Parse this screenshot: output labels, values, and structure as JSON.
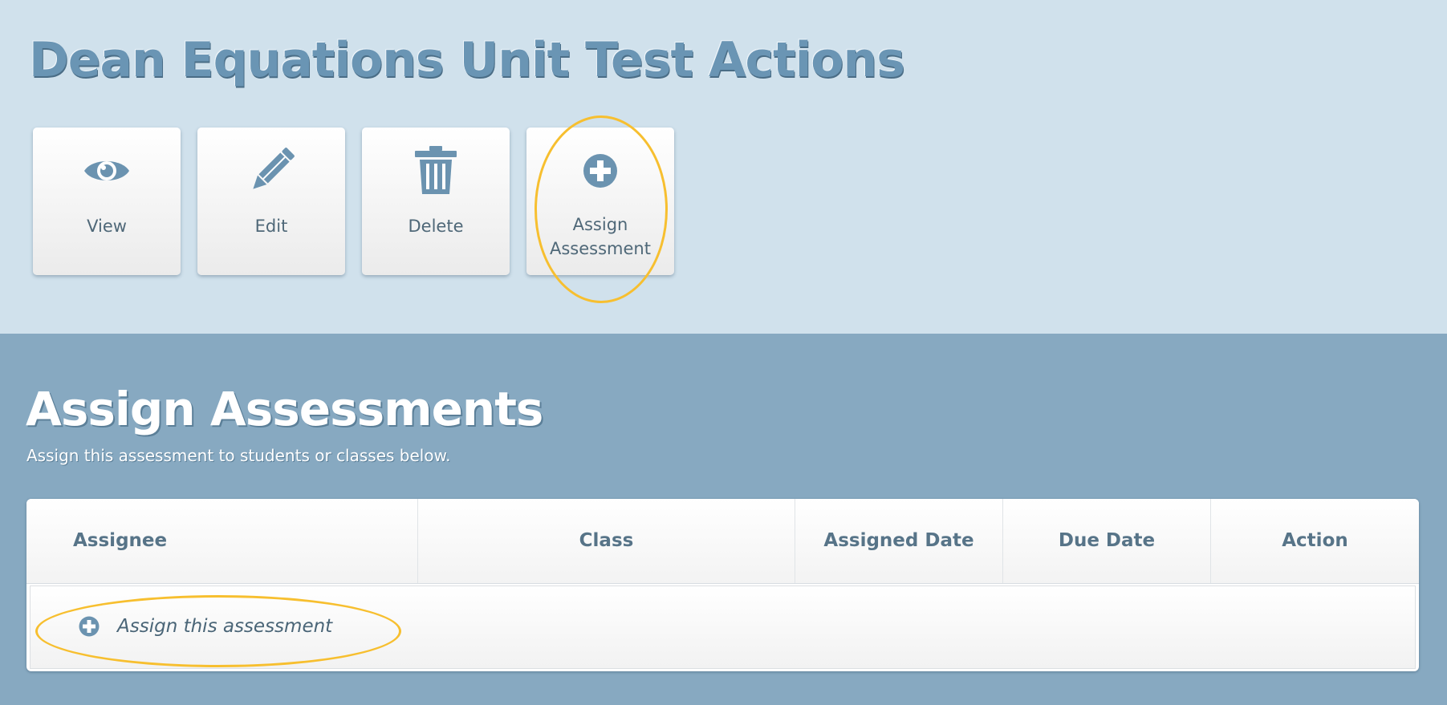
{
  "header": {
    "title": "Dean Equations Unit Test Actions"
  },
  "actions": [
    {
      "label": "View",
      "icon": "eye-icon"
    },
    {
      "label": "Edit",
      "icon": "pencil-icon"
    },
    {
      "label": "Delete",
      "icon": "trash-icon"
    },
    {
      "label": "Assign Assessment",
      "label_line1": "Assign",
      "label_line2": "Assessment",
      "icon": "plus-circle-icon"
    }
  ],
  "assign_section": {
    "title": "Assign Assessments",
    "subtitle": "Assign this assessment to students or classes below.",
    "table": {
      "columns": [
        "Assignee",
        "Class",
        "Assigned Date",
        "Due Date",
        "Action"
      ],
      "rows": []
    },
    "add_link": {
      "label": "Assign this assessment",
      "icon": "plus-circle-icon"
    }
  },
  "colors": {
    "top_background": "#d0e1ec",
    "section_background": "#87a9c1",
    "icon_color": "#6b93b0",
    "title_color": "#6a95b4",
    "highlight": "#f7bf2f"
  }
}
